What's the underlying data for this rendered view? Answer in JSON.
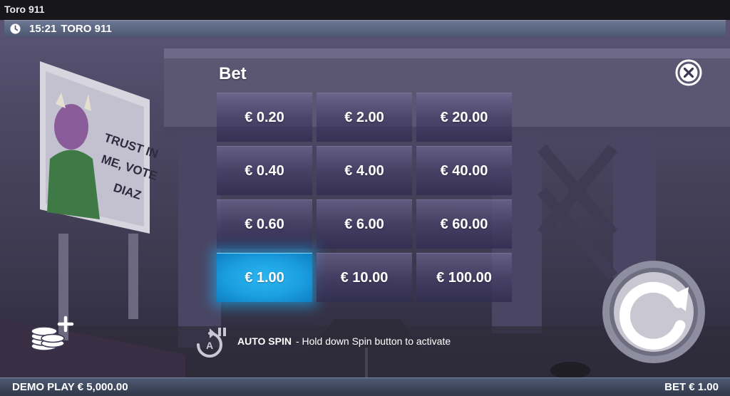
{
  "window": {
    "title": "Toro 911"
  },
  "status_bar": {
    "time": "15:21",
    "game_name": "TORO 911",
    "clock_icon": "clock-icon"
  },
  "bet_panel": {
    "heading": "Bet",
    "options": [
      {
        "label": "€ 0.20",
        "selected": false
      },
      {
        "label": "€ 2.00",
        "selected": false
      },
      {
        "label": "€ 20.00",
        "selected": false
      },
      {
        "label": "€ 0.40",
        "selected": false
      },
      {
        "label": "€ 4.00",
        "selected": false
      },
      {
        "label": "€ 40.00",
        "selected": false
      },
      {
        "label": "€ 0.60",
        "selected": false
      },
      {
        "label": "€ 6.00",
        "selected": false
      },
      {
        "label": "€ 60.00",
        "selected": false
      },
      {
        "label": "€ 1.00",
        "selected": true
      },
      {
        "label": "€ 10.00",
        "selected": false
      },
      {
        "label": "€ 100.00",
        "selected": false
      }
    ],
    "close_icon": "close-icon"
  },
  "background": {
    "billboard_text": [
      "TRUST IN",
      "ME, VOTE",
      "DIAZ"
    ]
  },
  "auto_spin": {
    "label": "AUTO SPIN",
    "hint": "- Hold down Spin button to activate",
    "badge": "A"
  },
  "bottom_bar": {
    "balance": "DEMO PLAY € 5,000.00",
    "bet": "BET € 1.00"
  },
  "colors": {
    "selected_bet": "#1ea6e6",
    "bar": "#4e5a73"
  }
}
